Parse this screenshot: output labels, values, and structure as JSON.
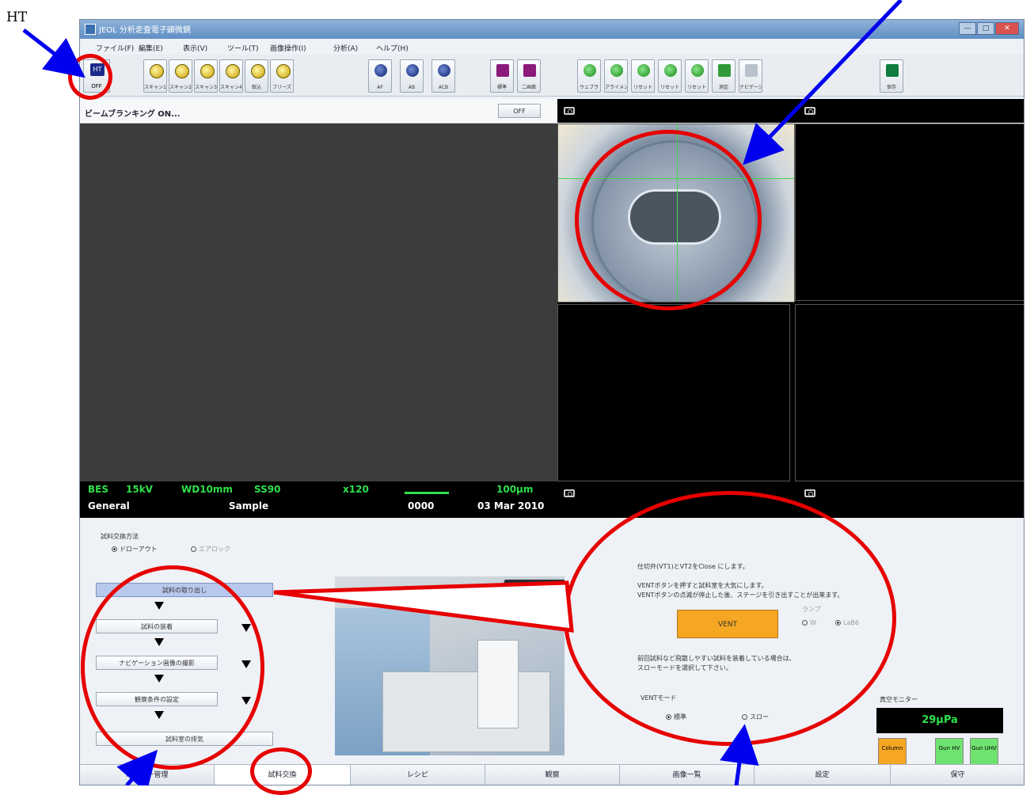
{
  "annotation": {
    "ht_label": "HT"
  },
  "window": {
    "title": "JEOL 分析走査電子顕微鏡",
    "buttons": {
      "minimize": "—",
      "maximize": "□",
      "close": "✕"
    }
  },
  "menu": [
    "ファイル(F)",
    "編集(E)",
    "表示(V)",
    "ツール(T)",
    "画像操作(I)",
    "分析(A)",
    "ヘルプ(H)"
  ],
  "toolbar": {
    "ht": {
      "icon_text": "HT",
      "label": "OFF"
    },
    "scan_buttons": [
      {
        "label": "スキャン1",
        "icon": "scan-icon"
      },
      {
        "label": "スキャン2",
        "icon": "scan-icon"
      },
      {
        "label": "スキャン3",
        "icon": "scan-icon"
      },
      {
        "label": "スキャン4",
        "icon": "scan-icon"
      },
      {
        "label": "取込",
        "icon": "capture-icon"
      },
      {
        "label": "フリーズ",
        "icon": "freeze-icon"
      }
    ],
    "auto_buttons": [
      {
        "label": "AF",
        "icon_text": "AF"
      },
      {
        "label": "AB",
        "icon_text": "AB"
      },
      {
        "label": "ACB",
        "icon_text": "ACB"
      }
    ],
    "view_buttons": [
      {
        "label": "標準"
      },
      {
        "label": "二画面"
      }
    ],
    "stage_buttons": [
      {
        "label": "ウェブラ"
      },
      {
        "label": "アライメント"
      },
      {
        "label": "リセット"
      },
      {
        "label": "リセット"
      },
      {
        "label": "リセット"
      },
      {
        "label": "測定"
      },
      {
        "label": "ナビゲーション"
      }
    ],
    "save": {
      "label": "保存"
    }
  },
  "infobar": {
    "message": "ビームブランキング ON...",
    "off_button": "OFF"
  },
  "status": {
    "detector": "BES",
    "kv": "15kV",
    "wd": "WD10mm",
    "ss": "SS90",
    "mag": "x120",
    "scale": "100µm",
    "mode": "General",
    "sample": "Sample",
    "number": "0000",
    "date": "03 Mar 2010"
  },
  "panel": {
    "exchange_method_label": "試料交換方法",
    "exchange_options": [
      {
        "label": "ドローアウト",
        "selected": true
      },
      {
        "label": "エアロック",
        "selected": false
      }
    ],
    "steps": [
      "試料の取り出し",
      "試料の装着",
      "ナビゲーション画像の撮影",
      "観察条件の設定",
      "試料室の排気"
    ],
    "instruction1": "仕切弁(VT1)とVT2をClose にします。",
    "instruction2": "VENTボタンを押すと試料室を大気にします。",
    "instruction3": "VENTボタンの点滅が停止した後、ステージを引き出すことが出来ます。",
    "vent_button": "VENT",
    "lamp_label": "ランプ",
    "lamp_options": [
      {
        "label": "W",
        "selected": false
      },
      {
        "label": "LaB6",
        "selected": true
      }
    ],
    "instruction4": "前回試料など飛散しやすい試料を装着している場合は、",
    "instruction5": "スローモードを選択して下さい。",
    "vent_mode_label": "VENTモード",
    "vent_mode_options": [
      {
        "label": "標準",
        "selected": true
      },
      {
        "label": "スロー",
        "selected": false
      }
    ],
    "vacuum_monitor_label": "真空モニター",
    "vacuum_value": "29µPa",
    "vacuum_buttons": [
      {
        "label": "Column",
        "color": "#f5a623"
      },
      {
        "label": "Gun HV",
        "color": "#6fe36f"
      },
      {
        "label": "Gun UHV",
        "color": "#6fe36f"
      }
    ]
  },
  "tabs": [
    "ユーザー管理",
    "試料交換",
    "レシピ",
    "観察",
    "画像一覧",
    "設定",
    "保守"
  ],
  "active_tab": 1
}
